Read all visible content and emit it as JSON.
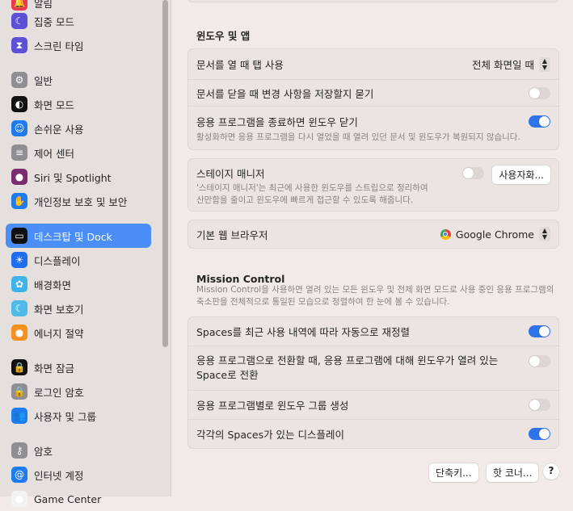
{
  "sidebar": {
    "items": [
      {
        "label": "알림",
        "icon": "bell-icon",
        "color": "#f0364f"
      },
      {
        "label": "집중 모드",
        "icon": "moon-icon",
        "color": "#5d4fd6"
      },
      {
        "label": "스크린 타임",
        "icon": "hourglass-icon",
        "color": "#5d4fd6"
      },
      {
        "label": "일반",
        "icon": "gear-icon",
        "color": "#8e8e93"
      },
      {
        "label": "화면 모드",
        "icon": "appearance-icon",
        "color": "#111111"
      },
      {
        "label": "손쉬운 사용",
        "icon": "accessibility-icon",
        "color": "#1f7cf0"
      },
      {
        "label": "제어 센터",
        "icon": "control-center-icon",
        "color": "#8e8e93"
      },
      {
        "label": "Siri 및 Spotlight",
        "icon": "siri-icon",
        "color": "#7a2c6e"
      },
      {
        "label": "개인정보 보호 및 보안",
        "icon": "hand-icon",
        "color": "#1f7cf0"
      },
      {
        "label": "데스크탑 및 Dock",
        "icon": "dock-icon",
        "color": "#111111"
      },
      {
        "label": "디스플레이",
        "icon": "sun-icon",
        "color": "#1f6ef0"
      },
      {
        "label": "배경화면",
        "icon": "flower-icon",
        "color": "#3cb4ea"
      },
      {
        "label": "화면 보호기",
        "icon": "screensaver-icon",
        "color": "#4fbbe8"
      },
      {
        "label": "에너지 절약",
        "icon": "lightbulb-icon",
        "color": "#f7901e"
      },
      {
        "label": "화면 잠금",
        "icon": "lock-screen-icon",
        "color": "#111111"
      },
      {
        "label": "로그인 암호",
        "icon": "lock-icon",
        "color": "#8e8e93"
      },
      {
        "label": "사용자 및 그룹",
        "icon": "users-icon",
        "color": "#1f7cf0"
      },
      {
        "label": "암호",
        "icon": "key-icon",
        "color": "#8e8e93"
      },
      {
        "label": "인터넷 계정",
        "icon": "at-icon",
        "color": "#1f7cf0"
      },
      {
        "label": "Game Center",
        "icon": "game-center-icon",
        "color": "#f2f2f2"
      }
    ],
    "selected": 9
  },
  "windows": {
    "heading": "윈도우 및 앱",
    "tabs_label": "문서를 열 때 탭 사용",
    "tabs_value": "전체 화면일 때",
    "ask_save_label": "문서를 닫을 때 변경 사항을 저장할지 묻기",
    "ask_save_on": false,
    "close_windows_label": "응용 프로그램을 종료하면 윈도우 닫기",
    "close_windows_on": true,
    "close_windows_sub": "활성화하면 응용 프로그램을 다시 열었을 때 열려 있던 문서 및 윈도우가 복원되지 않습니다.",
    "stage_label": "스테이지 매니저",
    "stage_on": false,
    "stage_sub1": "'스테이지 매니저'는 최근에 사용한 윈도우를 스트립으로 정리하여",
    "stage_sub2": "산만함을 줄이고 윈도우에 빠르게 접근할 수 있도록 해줍니다.",
    "customize_button": "사용자화...",
    "browser_label": "기본 웹 브라우저",
    "browser_value": "Google Chrome"
  },
  "mission": {
    "heading": "Mission Control",
    "desc1": "Mission Control을 사용하면 열려 있는 모든 윈도우 및 전체 화면 모드로 사용 중인 응용 프로그램의",
    "desc2": "축소판을 전체적으로 통일된 모습으로 정렬하여 한 눈에 볼 수 있습니다.",
    "rows": [
      {
        "label": "Spaces를 최근 사용 내역에 따라 자동으로 재정렬",
        "on": true
      },
      {
        "label": "응용 프로그램으로 전환할 때, 응용 프로그램에 대해 윈도우가 열려 있는",
        "label2": "Space로 전환",
        "on": false
      },
      {
        "label": "응용 프로그램별로 윈도우 그룹 생성",
        "on": false
      },
      {
        "label": "각각의 Spaces가 있는 디스플레이",
        "on": true
      }
    ]
  },
  "footer": {
    "shortcuts": "단축키...",
    "hot_corners": "핫 코너...",
    "help": "?"
  }
}
